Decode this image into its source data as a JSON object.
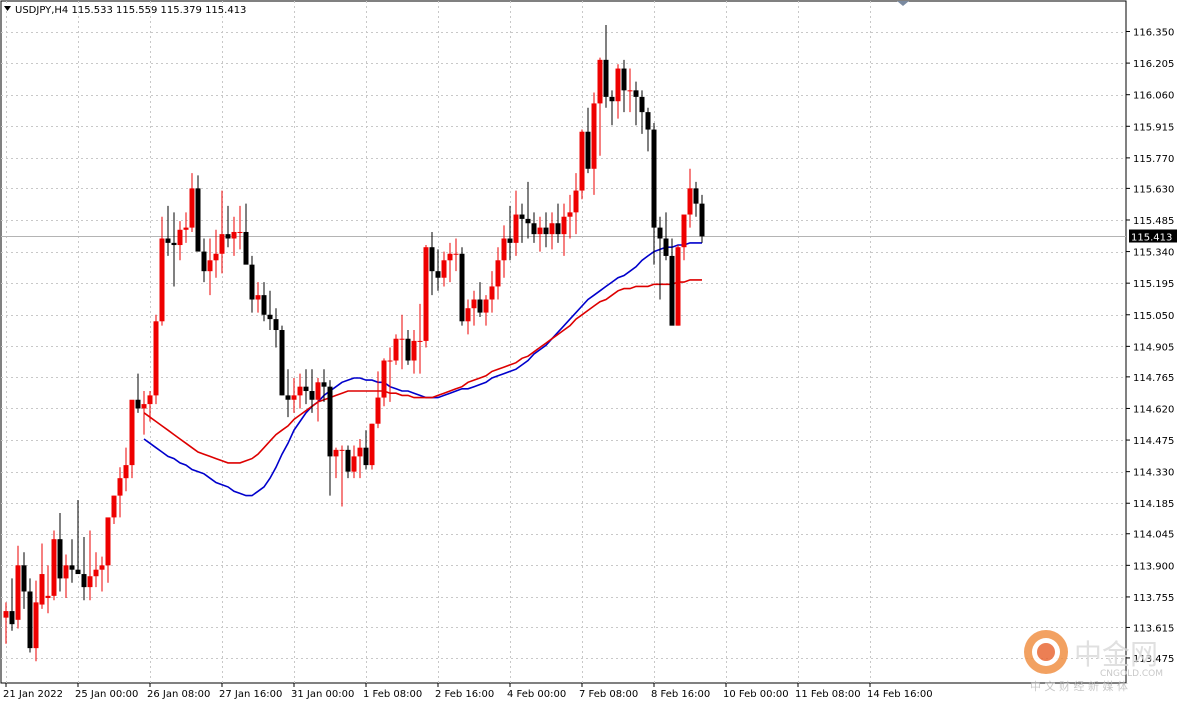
{
  "chart_data": {
    "type": "candlestick",
    "header": {
      "symbol": "USDJPY,H4",
      "open": "115.533",
      "high": "115.559",
      "low": "115.379",
      "close": "115.413"
    },
    "current_price_label": "115.413",
    "current_price": 115.413,
    "ylim": [
      113.36,
      116.49
    ],
    "grid": true,
    "y_ticks": [
      {
        "value": 116.35,
        "label": "116.350"
      },
      {
        "value": 116.205,
        "label": "116.205"
      },
      {
        "value": 116.06,
        "label": "116.060"
      },
      {
        "value": 115.915,
        "label": "115.915"
      },
      {
        "value": 115.77,
        "label": "115.770"
      },
      {
        "value": 115.63,
        "label": "115.630"
      },
      {
        "value": 115.485,
        "label": "115.485"
      },
      {
        "value": 115.34,
        "label": "115.340"
      },
      {
        "value": 115.195,
        "label": "115.195"
      },
      {
        "value": 115.05,
        "label": "115.050"
      },
      {
        "value": 114.905,
        "label": "114.905"
      },
      {
        "value": 114.765,
        "label": "114.765"
      },
      {
        "value": 114.62,
        "label": "114.620"
      },
      {
        "value": 114.475,
        "label": "114.475"
      },
      {
        "value": 114.33,
        "label": "114.330"
      },
      {
        "value": 114.185,
        "label": "114.185"
      },
      {
        "value": 114.045,
        "label": "114.045"
      },
      {
        "value": 113.9,
        "label": "113.900"
      },
      {
        "value": 113.755,
        "label": "113.755"
      },
      {
        "value": 113.615,
        "label": "113.615"
      },
      {
        "value": 113.475,
        "label": "113.475"
      }
    ],
    "x_ticks": [
      {
        "index": 0,
        "label": "21 Jan 2022"
      },
      {
        "index": 12,
        "label": "25 Jan 00:00"
      },
      {
        "index": 24,
        "label": "26 Jan 08:00"
      },
      {
        "index": 36,
        "label": "27 Jan 16:00"
      },
      {
        "index": 48,
        "label": "31 Jan 00:00"
      },
      {
        "index": 60,
        "label": "1 Feb 08:00"
      },
      {
        "index": 72,
        "label": "2 Feb 16:00"
      },
      {
        "index": 84,
        "label": "4 Feb 00:00"
      },
      {
        "index": 96,
        "label": "7 Feb 08:00"
      },
      {
        "index": 108,
        "label": "8 Feb 16:00"
      },
      {
        "index": 120,
        "label": "10 Feb 00:00"
      },
      {
        "index": 132,
        "label": "11 Feb 08:00"
      },
      {
        "index": 144,
        "label": "14 Feb 16:00"
      }
    ],
    "candles": [
      [
        113.66,
        113.73,
        113.54,
        113.69
      ],
      [
        113.69,
        113.84,
        113.6,
        113.63
      ],
      [
        113.65,
        113.99,
        113.61,
        113.9
      ],
      [
        113.9,
        113.96,
        113.7,
        113.78
      ],
      [
        113.78,
        113.84,
        113.5,
        113.52
      ],
      [
        113.52,
        113.83,
        113.46,
        113.73
      ],
      [
        113.72,
        114.0,
        113.7,
        113.86
      ],
      [
        113.75,
        113.9,
        113.68,
        113.76
      ],
      [
        113.76,
        114.06,
        113.74,
        114.02
      ],
      [
        114.02,
        114.14,
        113.78,
        113.84
      ],
      [
        113.84,
        113.95,
        113.75,
        113.9
      ],
      [
        113.9,
        114.02,
        113.82,
        113.88
      ],
      [
        113.88,
        114.2,
        113.86,
        113.86
      ],
      [
        113.86,
        114.03,
        113.74,
        113.8
      ],
      [
        113.8,
        114.06,
        113.74,
        113.85
      ],
      [
        113.85,
        113.96,
        113.8,
        113.88
      ],
      [
        113.88,
        113.94,
        113.78,
        113.9
      ],
      [
        113.9,
        114.02,
        113.82,
        114.12
      ],
      [
        114.12,
        114.22,
        114.09,
        114.22
      ],
      [
        114.22,
        114.35,
        114.12,
        114.3
      ],
      [
        114.3,
        114.44,
        114.24,
        114.36
      ],
      [
        114.36,
        114.45,
        114.3,
        114.66
      ],
      [
        114.66,
        114.78,
        114.6,
        114.62
      ],
      [
        114.62,
        114.7,
        114.5,
        114.64
      ],
      [
        114.64,
        114.7,
        114.56,
        114.68
      ],
      [
        114.68,
        115.05,
        114.64,
        115.02
      ],
      [
        115.02,
        115.5,
        115.0,
        115.4
      ],
      [
        115.4,
        115.55,
        115.32,
        115.38
      ],
      [
        115.38,
        115.52,
        115.18,
        115.37
      ],
      [
        115.37,
        115.48,
        115.3,
        115.44
      ],
      [
        115.44,
        115.52,
        115.38,
        115.45
      ],
      [
        115.45,
        115.7,
        115.43,
        115.63
      ],
      [
        115.63,
        115.69,
        115.4,
        115.34
      ],
      [
        115.34,
        115.4,
        115.2,
        115.25
      ],
      [
        115.25,
        115.4,
        115.14,
        115.3
      ],
      [
        115.3,
        115.44,
        115.22,
        115.33
      ],
      [
        115.33,
        115.62,
        115.24,
        115.42
      ],
      [
        115.42,
        115.55,
        115.36,
        115.4
      ],
      [
        115.4,
        115.5,
        115.32,
        115.43
      ],
      [
        115.43,
        115.55,
        115.35,
        115.43
      ],
      [
        115.43,
        115.56,
        115.34,
        115.28
      ],
      [
        115.28,
        115.32,
        115.06,
        115.12
      ],
      [
        115.12,
        115.2,
        115.06,
        115.14
      ],
      [
        115.14,
        115.2,
        115.02,
        115.05
      ],
      [
        115.05,
        115.16,
        114.98,
        115.03
      ],
      [
        115.03,
        115.08,
        114.9,
        114.98
      ],
      [
        114.98,
        115.0,
        114.68,
        114.68
      ],
      [
        114.68,
        114.8,
        114.58,
        114.66
      ],
      [
        114.66,
        114.76,
        114.6,
        114.68
      ],
      [
        114.68,
        114.78,
        114.62,
        114.72
      ],
      [
        114.72,
        114.8,
        114.64,
        114.7
      ],
      [
        114.7,
        114.8,
        114.6,
        114.66
      ],
      [
        114.66,
        114.76,
        114.56,
        114.74
      ],
      [
        114.74,
        114.8,
        114.65,
        114.72
      ],
      [
        114.72,
        114.75,
        114.22,
        114.4
      ],
      [
        114.4,
        114.44,
        114.3,
        114.43
      ],
      [
        114.43,
        114.45,
        114.17,
        114.43
      ],
      [
        114.43,
        114.45,
        114.3,
        114.33
      ],
      [
        114.33,
        114.45,
        114.3,
        114.4
      ],
      [
        114.4,
        114.48,
        114.3,
        114.44
      ],
      [
        114.44,
        114.52,
        114.34,
        114.36
      ],
      [
        114.36,
        114.55,
        114.34,
        114.55
      ],
      [
        114.55,
        114.79,
        114.53,
        114.67
      ],
      [
        114.67,
        114.85,
        114.63,
        114.84
      ],
      [
        114.84,
        114.9,
        114.65,
        114.84
      ],
      [
        114.84,
        114.96,
        114.82,
        114.94
      ],
      [
        114.94,
        115.05,
        114.8,
        114.94
      ],
      [
        114.94,
        114.98,
        114.82,
        114.84
      ],
      [
        114.84,
        114.98,
        114.78,
        114.93
      ],
      [
        114.93,
        115.1,
        114.78,
        114.93
      ],
      [
        114.93,
        115.37,
        114.9,
        115.36
      ],
      [
        115.36,
        115.43,
        115.14,
        115.25
      ],
      [
        115.25,
        115.35,
        115.16,
        115.22
      ],
      [
        115.22,
        115.34,
        115.18,
        115.3
      ],
      [
        115.3,
        115.38,
        115.2,
        115.33
      ],
      [
        115.33,
        115.4,
        115.25,
        115.33
      ],
      [
        115.33,
        115.36,
        115.0,
        115.02
      ],
      [
        115.02,
        115.12,
        114.96,
        115.08
      ],
      [
        115.08,
        115.16,
        115.0,
        115.12
      ],
      [
        115.12,
        115.2,
        115.04,
        115.06
      ],
      [
        115.06,
        115.14,
        115.0,
        115.12
      ],
      [
        115.12,
        115.25,
        115.06,
        115.18
      ],
      [
        115.18,
        115.36,
        115.12,
        115.3
      ],
      [
        115.3,
        115.46,
        115.22,
        115.4
      ],
      [
        115.4,
        115.55,
        115.3,
        115.38
      ],
      [
        115.38,
        115.62,
        115.32,
        115.51
      ],
      [
        115.51,
        115.56,
        115.38,
        115.49
      ],
      [
        115.49,
        115.66,
        115.4,
        115.47
      ],
      [
        115.47,
        115.52,
        115.38,
        115.42
      ],
      [
        115.42,
        115.5,
        115.34,
        115.45
      ],
      [
        115.45,
        115.52,
        115.36,
        115.42
      ],
      [
        115.42,
        115.52,
        115.35,
        115.47
      ],
      [
        115.47,
        115.56,
        115.38,
        115.42
      ],
      [
        115.42,
        115.56,
        115.32,
        115.5
      ],
      [
        115.5,
        115.6,
        115.4,
        115.52
      ],
      [
        115.52,
        115.7,
        115.42,
        115.62
      ],
      [
        115.62,
        115.9,
        115.58,
        115.89
      ],
      [
        115.89,
        116.0,
        115.7,
        115.72
      ],
      [
        115.72,
        116.07,
        115.6,
        116.02
      ],
      [
        116.02,
        116.23,
        115.78,
        116.22
      ],
      [
        116.22,
        116.38,
        116.0,
        116.05
      ],
      [
        116.05,
        116.08,
        115.92,
        116.03
      ],
      [
        116.03,
        116.2,
        115.95,
        116.18
      ],
      [
        116.18,
        116.22,
        115.98,
        116.08
      ],
      [
        116.08,
        116.18,
        115.98,
        116.08
      ],
      [
        116.08,
        116.12,
        115.92,
        116.05
      ],
      [
        116.05,
        116.08,
        115.88,
        115.98
      ],
      [
        115.98,
        116.0,
        115.8,
        115.9
      ],
      [
        115.9,
        115.93,
        115.28,
        115.45
      ],
      [
        115.45,
        115.5,
        115.12,
        115.4
      ],
      [
        115.4,
        115.52,
        115.3,
        115.32
      ],
      [
        115.32,
        115.4,
        115.03,
        115.0
      ],
      [
        115.0,
        115.37,
        115.0,
        115.36
      ],
      [
        115.36,
        115.48,
        115.3,
        115.51
      ],
      [
        115.51,
        115.72,
        115.45,
        115.63
      ],
      [
        115.63,
        115.66,
        115.5,
        115.56
      ],
      [
        115.56,
        115.6,
        115.38,
        115.41
      ]
    ],
    "series": [
      {
        "name": "",
        "color": "#0000cc",
        "values": [
          114.48,
          114.46,
          114.44,
          114.42,
          114.4,
          114.39,
          114.37,
          114.36,
          114.34,
          114.33,
          114.32,
          114.3,
          114.28,
          114.27,
          114.26,
          114.24,
          114.23,
          114.22,
          114.22,
          114.24,
          114.26,
          114.3,
          114.35,
          114.41,
          114.46,
          114.52,
          114.56,
          114.6,
          114.63,
          114.65,
          114.68,
          114.7,
          114.72,
          114.74,
          114.75,
          114.76,
          114.76,
          114.75,
          114.75,
          114.74,
          114.74,
          114.72,
          114.71,
          114.7,
          114.7,
          114.69,
          114.68,
          114.67,
          114.67,
          114.67,
          114.68,
          114.69,
          114.7,
          114.71,
          114.71,
          114.72,
          114.73,
          114.74,
          114.76,
          114.77,
          114.78,
          114.79,
          114.8,
          114.82,
          114.84,
          114.87,
          114.89,
          114.91,
          114.94,
          114.97,
          115.0,
          115.03,
          115.06,
          115.09,
          115.12,
          115.14,
          115.16,
          115.18,
          115.2,
          115.22,
          115.23,
          115.25,
          115.27,
          115.3,
          115.32,
          115.34,
          115.35,
          115.36,
          115.36,
          115.37,
          115.37,
          115.38,
          115.38,
          115.38
        ]
      },
      {
        "name": "",
        "color": "#dd0000",
        "values": [
          114.6,
          114.58,
          114.56,
          114.54,
          114.52,
          114.5,
          114.48,
          114.46,
          114.44,
          114.42,
          114.41,
          114.4,
          114.39,
          114.38,
          114.37,
          114.37,
          114.37,
          114.38,
          114.39,
          114.41,
          114.44,
          114.47,
          114.5,
          114.52,
          114.54,
          114.57,
          114.59,
          114.61,
          114.63,
          114.65,
          114.66,
          114.67,
          114.68,
          114.69,
          114.7,
          114.7,
          114.7,
          114.7,
          114.7,
          114.7,
          114.7,
          114.69,
          114.69,
          114.68,
          114.68,
          114.67,
          114.67,
          114.67,
          114.67,
          114.68,
          114.69,
          114.7,
          114.71,
          114.72,
          114.74,
          114.75,
          114.76,
          114.77,
          114.79,
          114.8,
          114.81,
          114.82,
          114.83,
          114.85,
          114.86,
          114.88,
          114.9,
          114.92,
          114.94,
          114.96,
          114.98,
          115.0,
          115.03,
          115.05,
          115.07,
          115.09,
          115.11,
          115.12,
          115.14,
          115.16,
          115.17,
          115.17,
          115.18,
          115.18,
          115.18,
          115.19,
          115.19,
          115.19,
          115.19,
          115.2,
          115.2,
          115.21,
          115.21,
          115.21
        ]
      }
    ]
  },
  "watermark": {
    "name_cn": "中金网",
    "name_en": "CNGOLD.COM",
    "tagline": "中 文 财 经 新 媒 体"
  }
}
